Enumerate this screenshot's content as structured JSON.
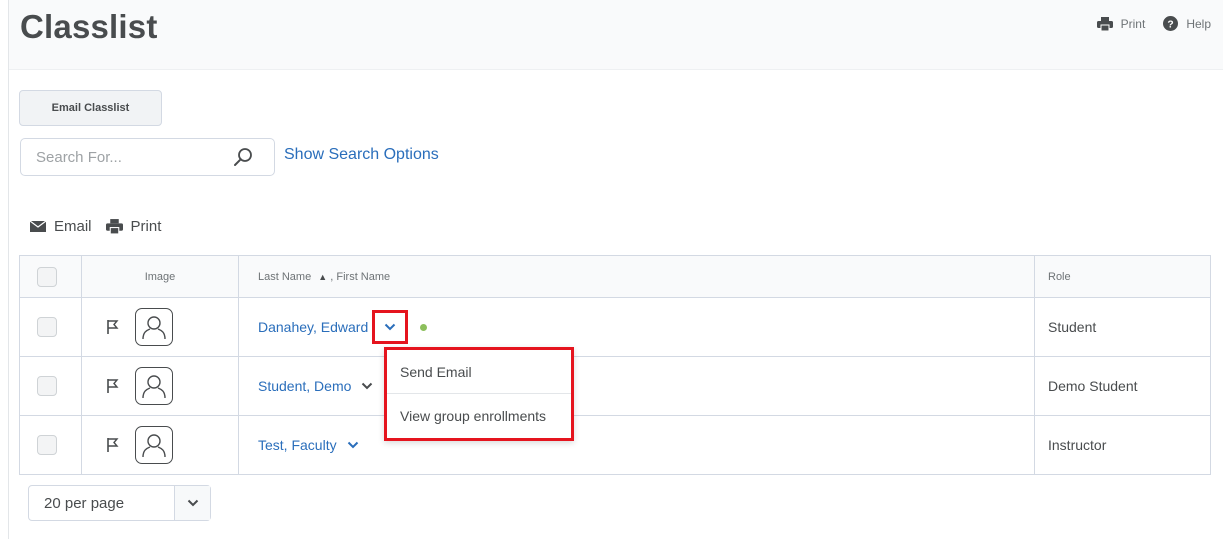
{
  "page": {
    "title": "Classlist",
    "print_label": "Print",
    "help_label": "Help"
  },
  "toolbar": {
    "email_classlist_label": "Email Classlist"
  },
  "search": {
    "placeholder": "Search For...",
    "value": "",
    "show_options_label": "Show Search Options"
  },
  "actions": {
    "email_label": "Email",
    "print_label": "Print"
  },
  "table": {
    "headers": {
      "image": "Image",
      "name": "Last Name",
      "sort_indicator": "▲",
      "name_suffix": ", First Name",
      "role": "Role"
    },
    "rows": [
      {
        "name": "Danahey, Edward",
        "role": "Student",
        "online": true
      },
      {
        "name": "Student, Demo",
        "role": "Demo Student",
        "online": false
      },
      {
        "name": "Test, Faculty",
        "role": "Instructor",
        "online": false
      }
    ]
  },
  "context_menu": {
    "items": [
      "Send Email",
      "View group enrollments"
    ]
  },
  "pagination": {
    "per_page_label": "20 per page"
  },
  "colors": {
    "link": "#2a6ebb",
    "highlight": "#e5141e",
    "online": "#8cbf5c",
    "text": "#494c4e"
  }
}
